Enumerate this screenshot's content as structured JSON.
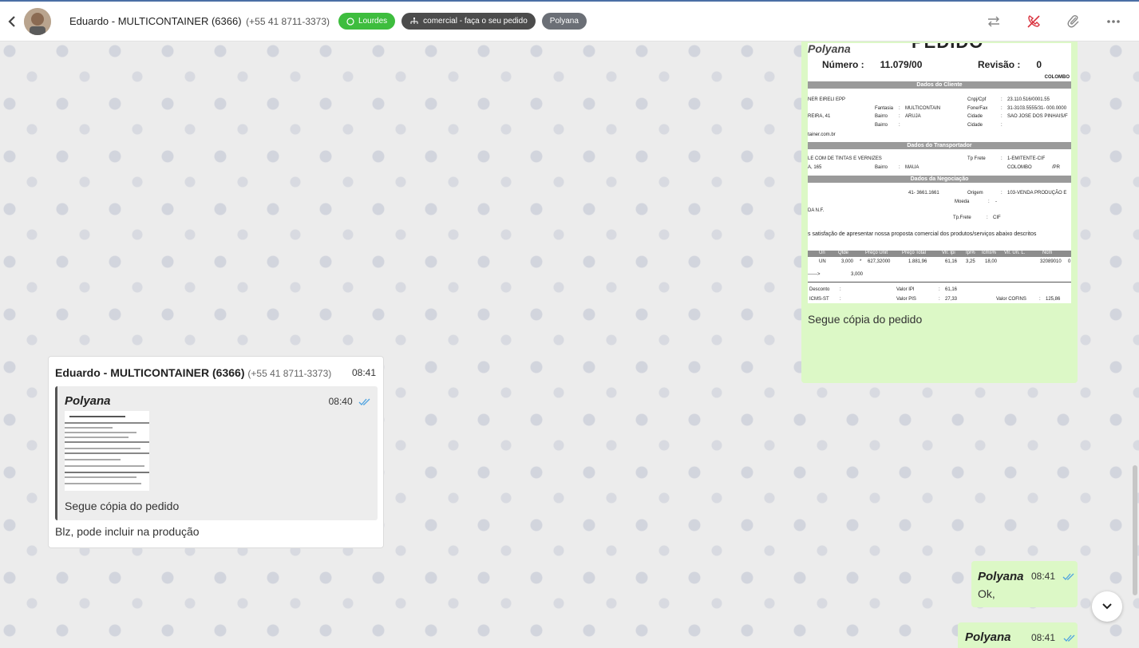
{
  "header": {
    "contact_name": "Eduardo - MULTICONTAINER (6366)",
    "contact_phone": "(+55 41 8711-3373)",
    "tags": [
      {
        "label": "Lourdes",
        "icon": "whatsapp-icon",
        "color": "#3ebd3e"
      },
      {
        "label": "comercial - faça o seu pedido",
        "icon": "sitemap-icon",
        "color": "#4c4c4c"
      },
      {
        "label": "Polyana",
        "icon": "",
        "color": "#6b6f76"
      }
    ],
    "actions": [
      "transfer-icon",
      "call-off-icon",
      "attachment-icon",
      "more-icon"
    ]
  },
  "messages": {
    "doc_message": {
      "caption": "Segue cópia do pedido",
      "document": {
        "author": "Polyana",
        "title": "PEDIDO",
        "numero_label": "Número :",
        "numero_value": "11.079/00",
        "revisao_label": "Revisão :",
        "revisao_value": "0",
        "city": "COLOMBO",
        "section_cliente": "Dados do Cliente",
        "section_transportador": "Dados do Transportador",
        "section_negociacao": "Dados da Negociação",
        "lines": [
          "NER EIRELI EPP",
          "Cnpj/Cpf",
          ":",
          "23.110.516/0001.55",
          "Fantasia",
          ":",
          "MULTICONTAIN",
          "Fone/Fax",
          ":",
          "31-3103.5555/31- 000.0000",
          "REIRA, 41",
          "Bairro",
          ":",
          "ARUJA",
          "Cidade",
          ":",
          "SAO JOSE DOS PINHAIS/F",
          "Bairro",
          ":",
          "Cidade",
          ":",
          "tainer.com.br",
          "LE COM DE TINTAS E VERNIZES",
          "Tp Frete",
          ":",
          "1-EMITENTE-CIF",
          "A, 165",
          "Bairro",
          ":",
          "MAUA",
          "COLOMBO",
          "/PR",
          "41- 3661.1661",
          "Origem",
          ":",
          "103-VENDA PRODUÇÃO E",
          "Moeda",
          ":",
          "-",
          "DA N.F.",
          "Tp.Frete",
          ":",
          "CIF",
          "s satisfação de apresentar nossa proposta comercial dos produtos/serviços abaixo descritos"
        ],
        "table_headers": [
          "Un",
          "Qtde",
          "Preço Unit",
          "Preço Total",
          "Vlr. Ipi",
          "Ipi%",
          "Icms%",
          "Vlr. Un. L.",
          "Ncm"
        ],
        "table_row": [
          "UN",
          "3,000",
          "*",
          "627,32000",
          "1.881,96",
          "61,16",
          "3,25",
          "18,00",
          "32089010",
          "0"
        ],
        "total_row": [
          "------>",
          "3,000"
        ],
        "footer": [
          "Desconto",
          ":",
          "Valor IPI",
          ":",
          "61,16",
          "ICMS-ST",
          ":",
          "Valor PIS",
          ":",
          "27,33",
          "Valor COFINS",
          ":",
          "125,86"
        ]
      }
    },
    "reply_message": {
      "sender": "Eduardo - MULTICONTAINER (6366)",
      "phone": "(+55 41 8711-3373)",
      "time": "08:41",
      "quoted": {
        "author": "Polyana",
        "time": "08:40",
        "caption": "Segue cópia do pedido"
      },
      "text": "Blz, pode incluir na produção"
    },
    "ok_message": {
      "author": "Polyana",
      "time": "08:41",
      "text": "Ok,"
    },
    "last_message": {
      "author": "Polyana",
      "time": "08:41"
    }
  },
  "colors": {
    "outgoing_bubble": "#dcf8c6",
    "incoming_bubble": "#ffffff",
    "tick": "#4fa3e0"
  }
}
